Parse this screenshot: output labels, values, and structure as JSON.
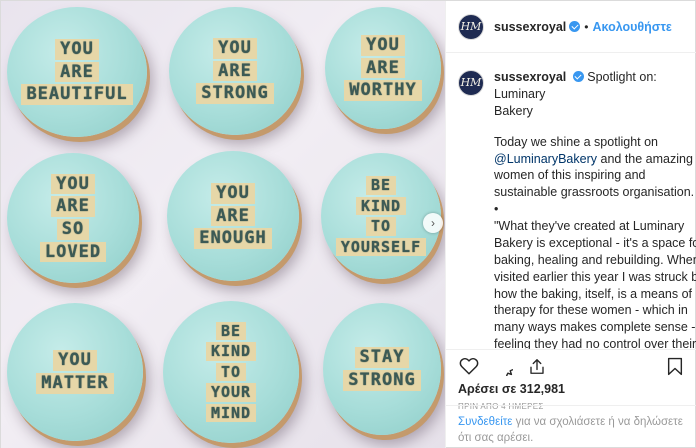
{
  "account": {
    "username": "sussexroyal",
    "follow_label": "Ακολουθήστε",
    "separator": "•",
    "avatar_monogram": "HM"
  },
  "caption": {
    "title_line1": "Spotlight on: Luminary",
    "title_line2": "Bakery",
    "para1_before": "Today we shine a spotlight on",
    "mention": "@LuminaryBakery",
    "para1_after": "and the amazing women of this inspiring and sustainable grassroots organisation.",
    "bullet": "•",
    "para2": "\"What they've created at Luminary Bakery is exceptional - it's a space for baking, healing and rebuilding. When I visited earlier this year I was struck by how the baking, itself, is a means of therapy for these women - which in many ways makes complete sense - feeling they had no control over their lives based on their previous (and often harrowing) circumstances, they found comfort in the measured nature of baking. Of the exact science of it."
  },
  "engagement": {
    "likes": "Αρέσει σε 312,981",
    "timestamp": "ΠΡΙΝ ΑΠΟ 4 ΗΜΕΡΕΣ"
  },
  "login_prompt": {
    "link": "Συνδεθείτε",
    "text": "για να σχολιάσετε ή να δηλώσετε ότι σας αρέσει."
  },
  "icons": {
    "like": "heart-icon",
    "comment": "comment-icon",
    "share": "share-icon",
    "save": "bookmark-icon",
    "next": "chevron-right-icon"
  },
  "colors": {
    "link": "#3897f0",
    "mention": "#003569",
    "icing": "#a7ddd9",
    "fondant_text": "#e6d7a8"
  },
  "photo": {
    "cupcakes": [
      {
        "lines": [
          "YOU",
          "ARE",
          "BEAUTIFUL"
        ]
      },
      {
        "lines": [
          "YOU",
          "ARE",
          "STRONG"
        ]
      },
      {
        "lines": [
          "YOU",
          "ARE",
          "WORTHY"
        ]
      },
      {
        "lines": [
          "YOU",
          "ARE",
          "SO",
          "LOVED"
        ]
      },
      {
        "lines": [
          "YOU",
          "ARE",
          "ENOUGH"
        ]
      },
      {
        "lines": [
          "BE",
          "KIND",
          "TO",
          "YOURSELF"
        ]
      },
      {
        "lines": [
          "YOU",
          "MATTER"
        ]
      },
      {
        "lines": [
          "BE",
          "KIND",
          "TO",
          "YOUR",
          "MIND"
        ]
      },
      {
        "lines": [
          "STAY",
          "STRONG"
        ]
      }
    ]
  }
}
